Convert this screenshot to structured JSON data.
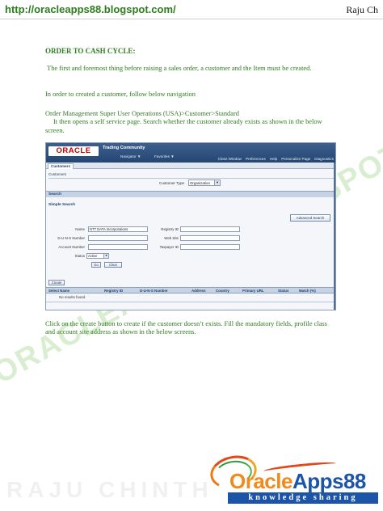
{
  "header": {
    "url": "http://oracleapps88.blogspot.com/",
    "author": "Raju Ch"
  },
  "document": {
    "title": "ORDER TO CASH CYCLE:",
    "para1": "The first and foremost thing before raising a sales order, a customer and the Item must be created.",
    "para2": "In order to created a customer, follow below navigation",
    "para3_line1": "Order Management Super User Operations (USA)>Customer>Standard",
    "para3_line2": "It then opens a self service page. Search whether the customer already exists as shown in the below screen.",
    "para4": "Click on the create button to create if the customer doesn’t exists. Fill the mandatory fields, profile class and account site address as shown in the below screens."
  },
  "screenshot": {
    "logo_text": "ORACLE",
    "app_name": "Trading Community",
    "navigator": "Navigator ▼",
    "favorites": "Favorites ▼",
    "global_links": [
      "Close Window",
      "Preferences",
      "Help",
      "Personalize Page",
      "Diagnostics"
    ],
    "tab": "Customers",
    "subnav": "Customers",
    "customer_type_label": "Customer Type",
    "customer_type_value": "Organization",
    "search_header": "Search",
    "simple_search": "Simple Search",
    "advanced_search": "Advanced Search",
    "fields": {
      "name_label": "Name",
      "name_value": "NTT DATA Incorporations",
      "duns_label": "D-U-N-S Number",
      "account_label": "Account Number",
      "status_label": "Status",
      "status_value": "Active",
      "registry_label": "Registry ID",
      "website_label": "Web Site",
      "taxpayer_label": "Taxpayer ID"
    },
    "go_label": "Go",
    "clear_label": "Clear",
    "create_label": "Create",
    "columns": [
      "Select Name",
      "Registry ID",
      "D-U-N-S Number",
      "Address",
      "Country",
      "Primary URL",
      "Status",
      "Match (%)"
    ],
    "no_results": "No results found."
  },
  "watermarks": {
    "diagonal": "ORACLEAPPS88.BLOGSPOT.COM",
    "bottom": "RAJU CHINTH"
  },
  "logo": {
    "brand_part1": "Oracle",
    "brand_part2": "Apps88",
    "tagline": "knowledge sharing"
  },
  "colors": {
    "text_green": "#2e7d1f",
    "oracle_header": "#254673",
    "logo_orange": "#f08a1a",
    "logo_blue": "#1c54a8"
  }
}
